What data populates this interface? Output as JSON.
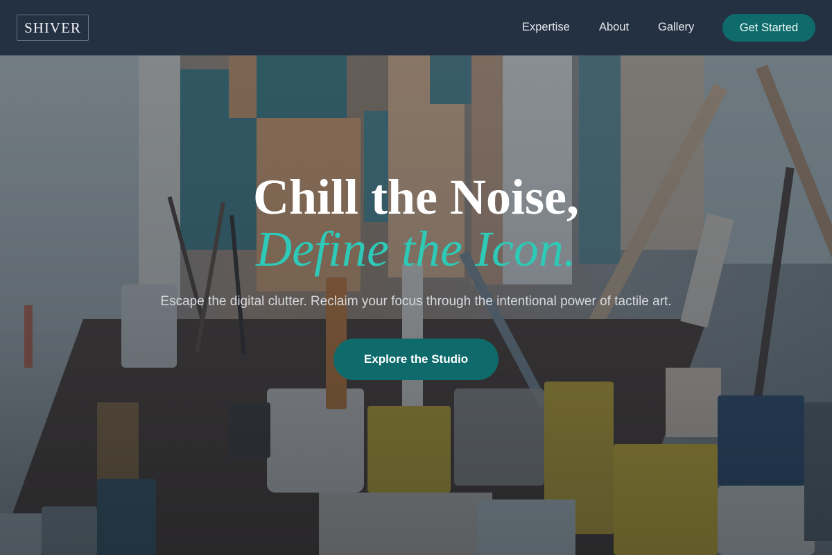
{
  "brand": {
    "logo_text": "SHIVER"
  },
  "nav": {
    "items": [
      {
        "label": "Expertise"
      },
      {
        "label": "About"
      },
      {
        "label": "Gallery"
      }
    ],
    "cta_label": "Get Started"
  },
  "hero": {
    "headline_line1": "Chill the Noise,",
    "headline_line2": "Define the Icon.",
    "subtitle": "Escape the digital clutter. Reclaim your focus through the intentional power of tactile art.",
    "cta_label": "Explore the Studio"
  },
  "colors": {
    "header_bg": "#243142",
    "accent_teal": "#0f6b6b",
    "headline_accent": "#2ec9b7",
    "text_light": "#e5e7eb"
  }
}
